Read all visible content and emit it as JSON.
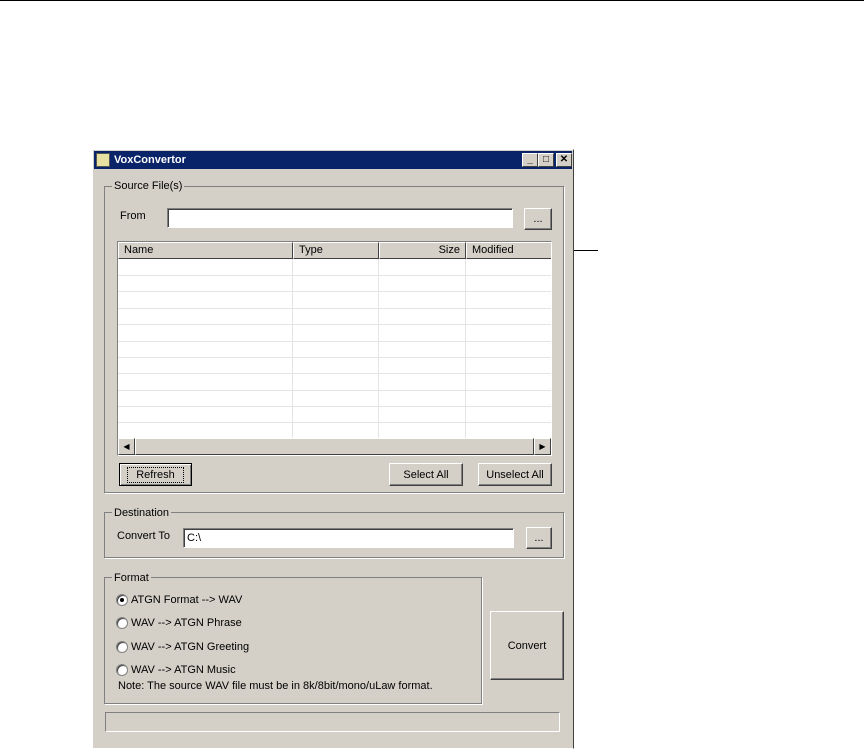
{
  "window": {
    "title": "VoxConvertor",
    "minimize": "_",
    "maximize": "□",
    "close": "✕"
  },
  "source": {
    "group_label": "Source File(s)",
    "from_label": "From",
    "from_value": "",
    "browse_label": "...",
    "columns": [
      "Name",
      "Type",
      "Size",
      "Modified"
    ],
    "scroll_left": "◀",
    "scroll_right": "▶",
    "refresh_label": "Refresh",
    "select_all_label": "Select All",
    "unselect_all_label": "Unselect All"
  },
  "destination": {
    "group_label": "Destination",
    "convert_to_label": "Convert To",
    "convert_to_value": "C:\\",
    "browse_label": "..."
  },
  "format": {
    "group_label": "Format",
    "options": [
      {
        "label": "ATGN Format --> WAV",
        "selected": true
      },
      {
        "label": "WAV --> ATGN Phrase",
        "selected": false
      },
      {
        "label": "WAV --> ATGN Greeting",
        "selected": false
      },
      {
        "label": "WAV --> ATGN Music",
        "selected": false
      }
    ],
    "note": "Note: The source WAV file must be in 8k/8bit/mono/uLaw format."
  },
  "convert_label": "Convert",
  "status": ""
}
